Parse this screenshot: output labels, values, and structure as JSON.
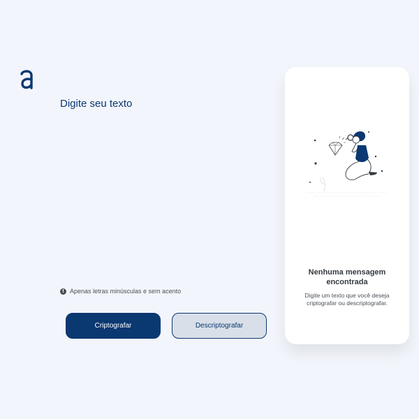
{
  "app": {
    "logo_icon": "alura-a-logo-icon",
    "accent_color": "#0a3871"
  },
  "input": {
    "placeholder": "Digite seu texto",
    "value": ""
  },
  "hint": {
    "icon": "info-icon",
    "text": "Apenas letras minúsculas e sem acento"
  },
  "buttons": {
    "encrypt_label": "Criptografar",
    "decrypt_label": "Descriptografar"
  },
  "output_panel": {
    "illustration": "person-with-magnifying-glass-illustration",
    "title": "Nenhuma mensagem encontrada",
    "subtitle": "Digite um texto que você deseja criptografar ou descriptografar."
  }
}
